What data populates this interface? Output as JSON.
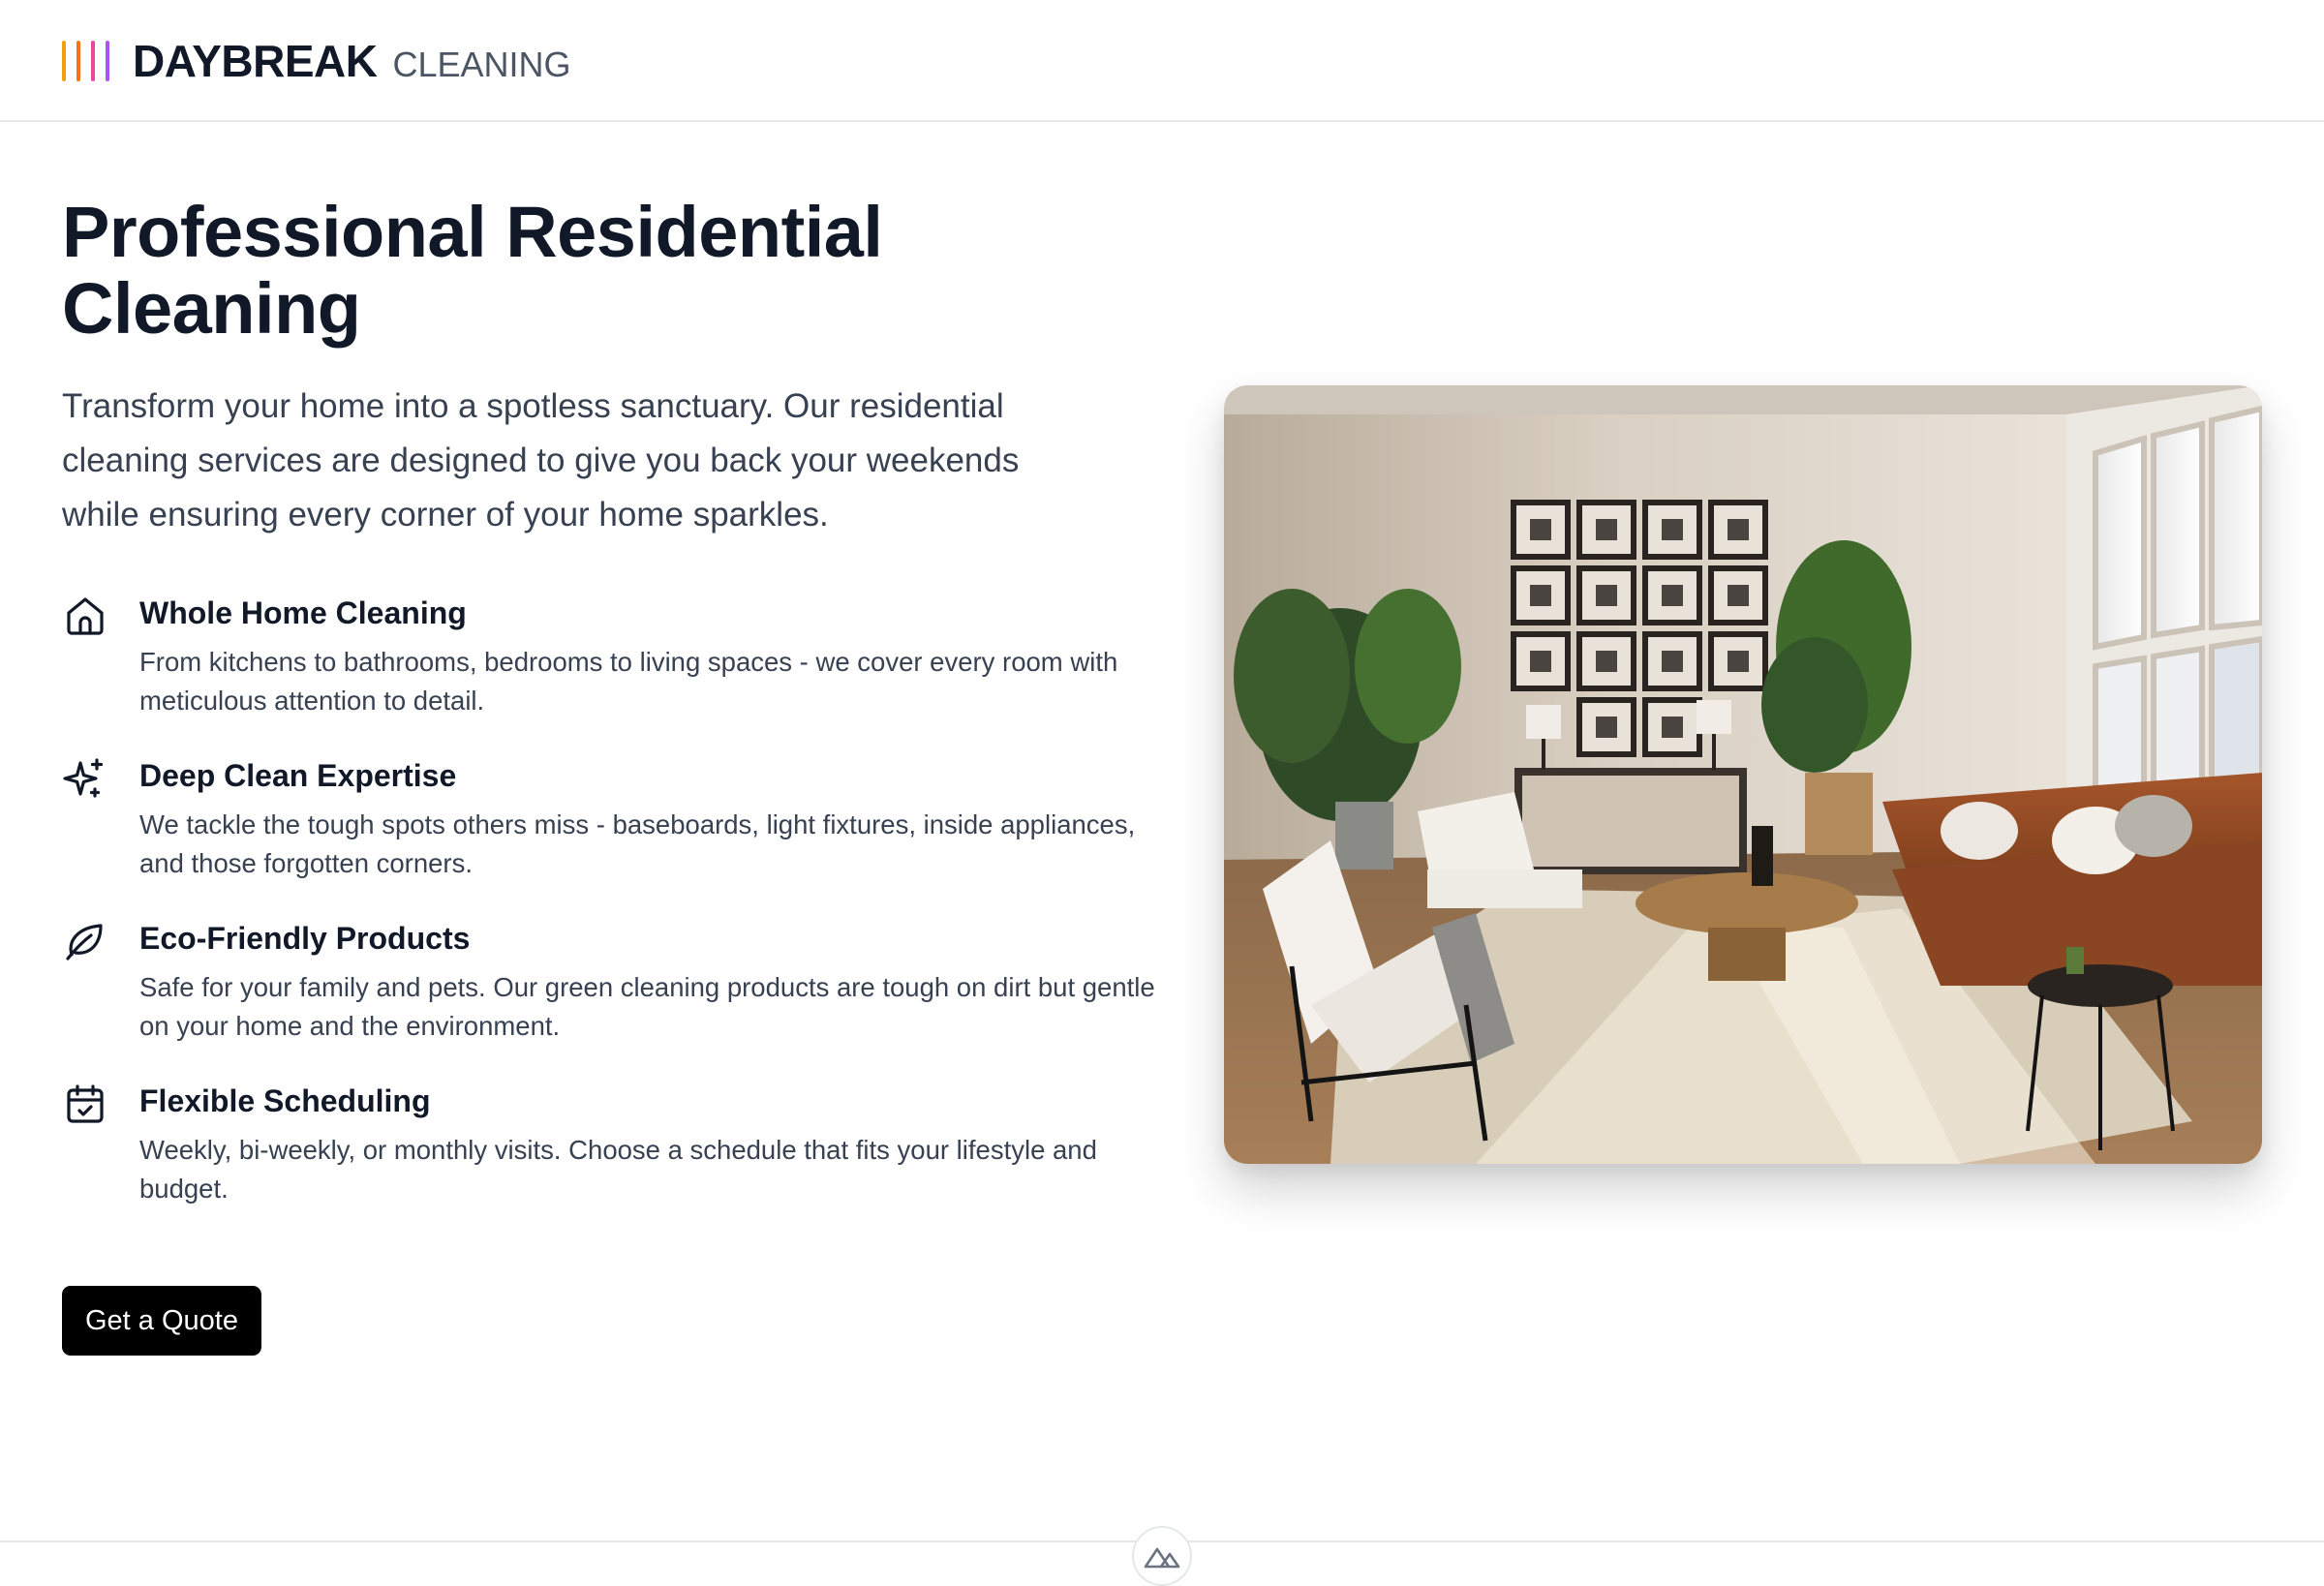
{
  "brand": {
    "name": "DAYBREAK",
    "subtitle": "CLEANING",
    "bar_colors": [
      "#f59e0b",
      "#f97316",
      "#ec4899",
      "#a855f7"
    ]
  },
  "hero": {
    "title_line1": "Professional Residential",
    "title_line2": "Cleaning",
    "intro": "Transform your home into a spotless sanctuary. Our residential cleaning services are designed to give you back your weekends while ensuring every corner of your home sparkles.",
    "cta_label": "Get a Quote"
  },
  "features": [
    {
      "icon": "home-icon",
      "title": "Whole Home Cleaning",
      "description": "From kitchens to bathrooms, bedrooms to living spaces - we cover every room with meticulous attention to detail."
    },
    {
      "icon": "sparkles-icon",
      "title": "Deep Clean Expertise",
      "description": "We tackle the tough spots others miss - baseboards, light fixtures, inside appliances, and those forgotten corners."
    },
    {
      "icon": "leaf-icon",
      "title": "Eco-Friendly Products",
      "description": "Safe for your family and pets. Our green cleaning products are tough on dirt but gentle on your home and the environment."
    },
    {
      "icon": "calendar-check-icon",
      "title": "Flexible Scheduling",
      "description": "Weekly, bi-weekly, or monthly visits. Choose a schedule that fits your lifestyle and budget."
    }
  ],
  "image": {
    "subject": "living-room-photo"
  },
  "footer": {
    "badge_icon": "mountain-logo-icon"
  }
}
